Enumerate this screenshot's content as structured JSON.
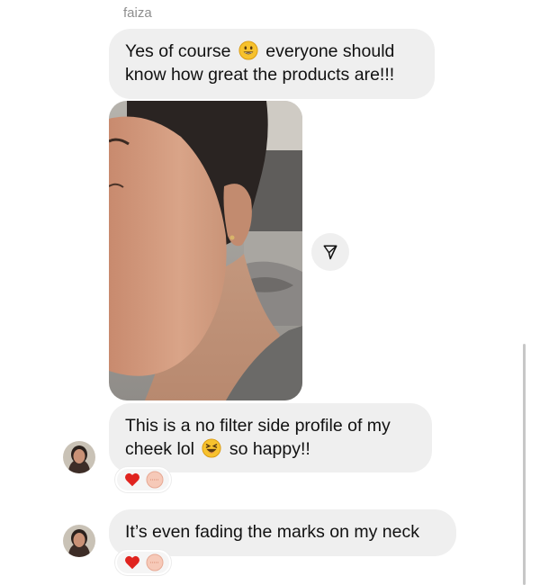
{
  "sender": {
    "name": "faiza"
  },
  "messages": [
    {
      "line1_a": "Yes of course",
      "line1_b": "everyone should",
      "line2": "know how great the products are!!!",
      "emoji": "smiling-emoji"
    },
    {
      "line1": "This is a no filter side profile of my",
      "line2_a": "cheek lol",
      "line2_b": "so happy!!",
      "emoji": "laughing-emoji"
    },
    {
      "text": "It’s even fading the marks on my neck"
    }
  ],
  "reactions": [
    {
      "items": [
        "red-heart-icon",
        "reaction-face-icon"
      ]
    },
    {
      "items": [
        "red-heart-icon",
        "reaction-face-icon"
      ]
    }
  ],
  "colors": {
    "bubble": "#efefef",
    "heart": "#e0241f",
    "name": "#8e8e8e"
  }
}
